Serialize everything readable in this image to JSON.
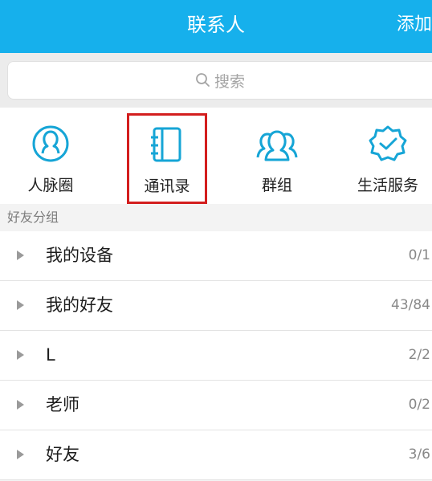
{
  "header": {
    "title": "联系人",
    "action_label": "添加"
  },
  "search": {
    "placeholder": "搜索",
    "icon": "search-icon"
  },
  "quick_actions": [
    {
      "label": "人脉圈",
      "icon": "person-circle-icon"
    },
    {
      "label": "通讯录",
      "icon": "address-book-icon",
      "selected": true
    },
    {
      "label": "群组",
      "icon": "group-icon"
    },
    {
      "label": "生活服务",
      "icon": "verified-badge-icon"
    }
  ],
  "groups_section": {
    "title": "好友分组"
  },
  "groups": [
    {
      "name": "我的设备",
      "count": "0/1"
    },
    {
      "name": "我的好友",
      "count": "43/84"
    },
    {
      "name": "L",
      "count": "2/2"
    },
    {
      "name": "老师",
      "count": "0/2"
    },
    {
      "name": "好友",
      "count": "3/6"
    }
  ],
  "colors": {
    "header_bg": "#16b0ec",
    "accent_icon": "#16a5d6",
    "selection_border": "#d31e1e"
  }
}
